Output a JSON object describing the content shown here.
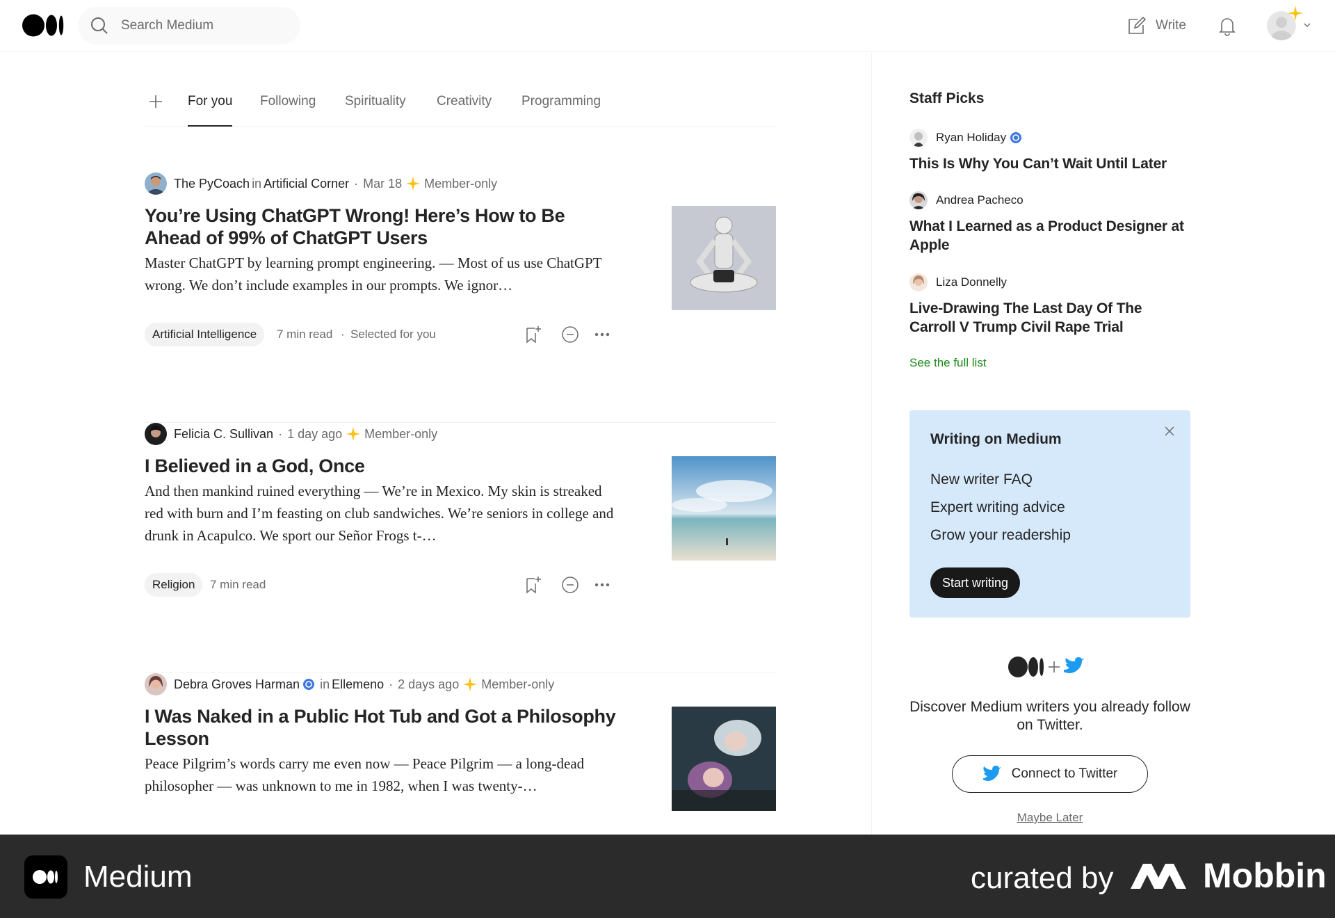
{
  "header": {
    "search_placeholder": "Search Medium",
    "write_label": "Write"
  },
  "tabs": {
    "items": [
      "For you",
      "Following",
      "Spirituality",
      "Creativity",
      "Programming"
    ],
    "active": "For you"
  },
  "articles": [
    {
      "author": "The PyCoach",
      "in_label": "in",
      "publication": "Artificial Corner",
      "date": "Mar 18",
      "member_label": "Member-only",
      "title": "You’re Using ChatGPT Wrong! Here’s How to Be Ahead of 99% of ChatGPT Users",
      "subtitle": "Master ChatGPT by learning prompt engineering. — Most of us use ChatGPT wrong. We don’t include examples in our prompts. We ignor…",
      "tag": "Artificial Intelligence",
      "read_time": "7 min read",
      "reason": "Selected for you"
    },
    {
      "author": "Felicia C. Sullivan",
      "date": "1 day ago",
      "member_label": "Member-only",
      "title": "I Believed in a God, Once",
      "subtitle": "And then mankind ruined everything — We’re in Mexico. My skin is streaked red with burn and I’m feasting on club sandwiches. We’re seniors in college and drunk in Acapulco. We sport our Señor Frogs t-…",
      "tag": "Religion",
      "read_time": "7 min read"
    },
    {
      "author": "Debra Groves Harman",
      "in_label": "in",
      "publication": "Ellemeno",
      "date": "2 days ago",
      "member_label": "Member-only",
      "title": "I Was Naked in a Public Hot Tub and Got a Philosophy Lesson",
      "subtitle": "Peace Pilgrim’s words carry me even now — Peace Pilgrim — a long-dead philosopher — was unknown to me in 1982, when I was twenty-…"
    }
  ],
  "sidebar": {
    "staff_picks_title": "Staff Picks",
    "picks": [
      {
        "author": "Ryan Holiday",
        "title": "This Is Why You Can’t Wait Until Later"
      },
      {
        "author": "Andrea Pacheco",
        "title": "What I Learned as a Product Designer at Apple"
      },
      {
        "author": "Liza Donnelly",
        "title": "Live-Drawing The Last Day Of The Carroll V Trump Civil Rape Trial"
      }
    ],
    "see_full_list": "See the full list",
    "writing_card": {
      "title": "Writing on Medium",
      "links": [
        "New writer FAQ",
        "Expert writing advice",
        "Grow your readership"
      ],
      "cta": "Start writing"
    },
    "twitter": {
      "text": "Discover Medium writers you already follow on Twitter.",
      "button": "Connect to Twitter",
      "maybe_later": "Maybe Later"
    }
  },
  "branding": {
    "app_name": "Medium",
    "curated_by": "curated by",
    "curator": "Mobbin"
  },
  "colors": {
    "accent_green": "#1a8917",
    "member_star": "#ffc017",
    "verified_blue": "#4178e0",
    "card_blue": "#d6e9fb",
    "twitter_blue": "#1d9bf0"
  }
}
